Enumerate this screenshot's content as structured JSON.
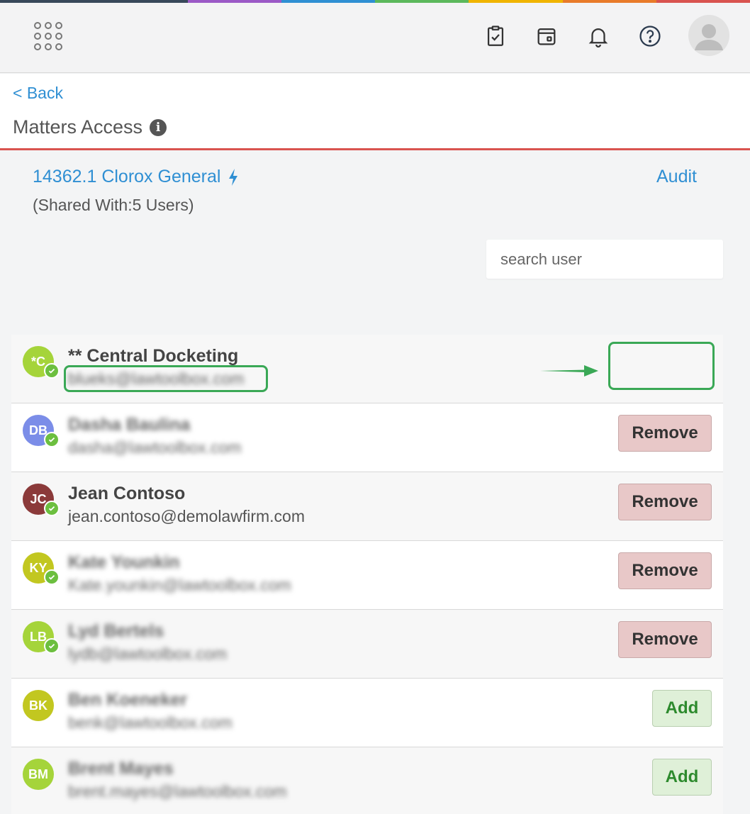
{
  "colors": {
    "rainbow": [
      "#38485a",
      "#38485a",
      "#9b59c6",
      "#2f8fd3",
      "#5cb85c",
      "#f0b400",
      "#e87b2a",
      "#d9534f"
    ],
    "link": "#2f8fd3",
    "remove_bg": "#e8c8c8",
    "add_bg": "#dff0d8",
    "highlight": "#3aa856"
  },
  "topbar": {
    "apps_icon": "grid-icon",
    "icons": [
      "clipboard-check-icon",
      "calendar-icon",
      "bell-icon",
      "help-icon",
      "user-avatar-icon"
    ]
  },
  "header": {
    "back_label": "< Back",
    "title": "Matters Access",
    "info_icon": "i"
  },
  "matter": {
    "name": "14362.1 Clorox General",
    "shared": "(Shared With:5 Users)",
    "audit_label": "Audit"
  },
  "search": {
    "placeholder": "search user"
  },
  "users": [
    {
      "initials": "*C",
      "color": "#a5d43a",
      "name": "** Central Docketing",
      "email": "blueks@lawtoolbox.com",
      "blurred_name": false,
      "blurred_email": true,
      "action": "",
      "checked": true
    },
    {
      "initials": "DB",
      "color": "#7b8de8",
      "name": "Dasha Baulina",
      "email": "dasha@lawtoolbox.com",
      "blurred_name": true,
      "blurred_email": true,
      "action": "Remove",
      "checked": true
    },
    {
      "initials": "JC",
      "color": "#8b3a3a",
      "name": "Jean Contoso",
      "email": "jean.contoso@demolawfirm.com",
      "blurred_name": false,
      "blurred_email": false,
      "action": "Remove",
      "checked": true
    },
    {
      "initials": "KY",
      "color": "#c2c720",
      "name": "Kate Younkin",
      "email": "Kate.younkin@lawtoolbox.com",
      "blurred_name": true,
      "blurred_email": true,
      "action": "Remove",
      "checked": true
    },
    {
      "initials": "LB",
      "color": "#a5d43a",
      "name": "Lyd Bertels",
      "email": "lydb@lawtoolbox.com",
      "blurred_name": true,
      "blurred_email": true,
      "action": "Remove",
      "checked": true
    },
    {
      "initials": "BK",
      "color": "#c2c720",
      "name": "Ben Koeneker",
      "email": "benk@lawtoolbox.com",
      "blurred_name": true,
      "blurred_email": true,
      "action": "Add",
      "checked": false
    },
    {
      "initials": "BM",
      "color": "#a5d43a",
      "name": "Brent Mayes",
      "email": "brent.mayes@lawtoolbox.com",
      "blurred_name": true,
      "blurred_email": true,
      "action": "Add",
      "checked": false
    }
  ]
}
